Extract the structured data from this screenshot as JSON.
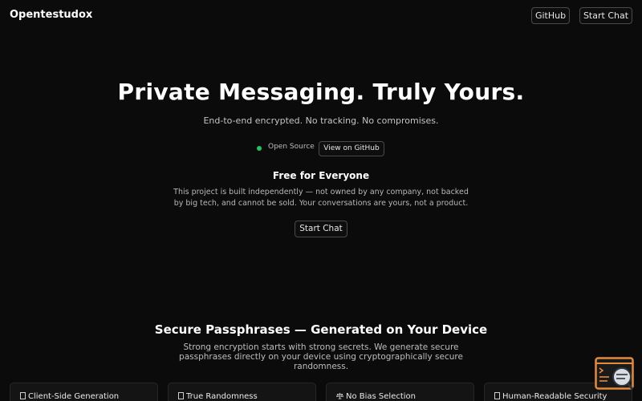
{
  "header": {
    "brand": "Opentestudox",
    "github_label": "GitHub",
    "start_chat_label": "Start Chat"
  },
  "hero": {
    "title": "Private Messaging. Truly Yours.",
    "subtitle": "End-to-end encrypted. No tracking. No compromises.",
    "status_text": "Open Source",
    "status_color": "#22c55e",
    "view_github_label": "View on GitHub"
  },
  "free": {
    "title": "Free for Everyone",
    "description": "This project is built independently — not owned by any company, not backed by big tech, and cannot be sold. Your conversations are yours, not a product.",
    "start_chat_label": "Start Chat"
  },
  "security": {
    "title": "Secure Passphrases — Generated on Your Device",
    "description": "Strong encryption starts with strong secrets. We generate secure passphrases directly on your device using cryptographically secure randomness.",
    "cards": [
      {
        "icon": "missing-glyph-icon",
        "title": "Client-Side Generation"
      },
      {
        "icon": "missing-glyph-icon",
        "title": "True Randomness"
      },
      {
        "icon": "scales-icon",
        "title": "No Bias Selection"
      },
      {
        "icon": "missing-glyph-icon",
        "title": "Human-Readable Security"
      }
    ]
  },
  "widget": {
    "icon": "chat-search-icon",
    "accent": "#e58a3a"
  }
}
